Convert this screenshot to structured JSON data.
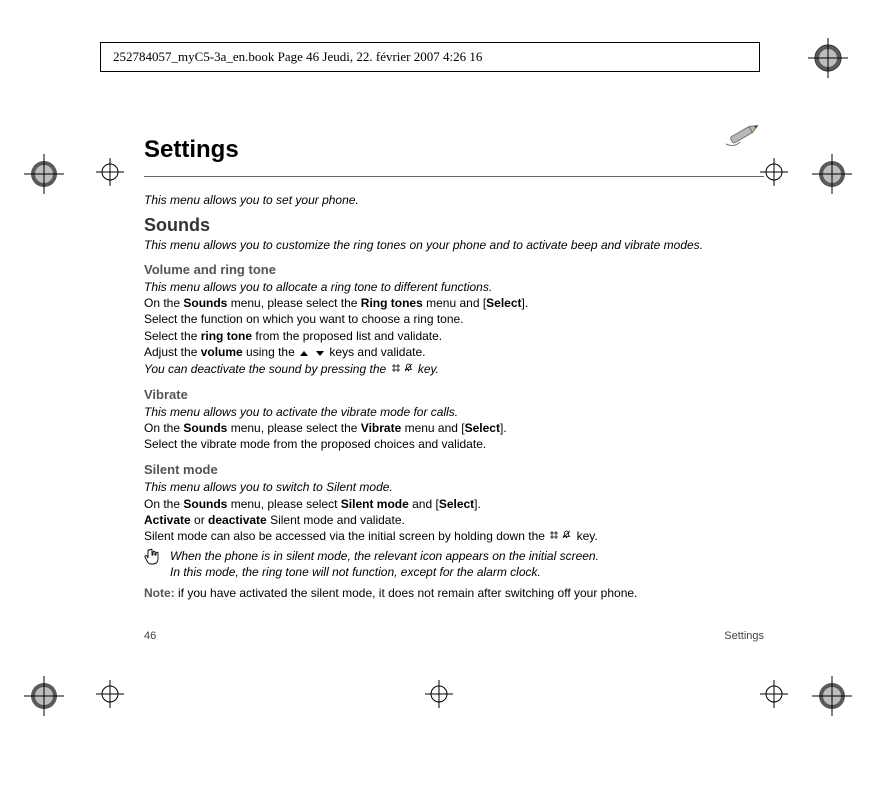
{
  "header": {
    "crop_text": "252784057_myC5-3a_en.book  Page 46  Jeudi, 22. février 2007  4:26 16"
  },
  "title": "Settings",
  "intro": "This menu allows you to set your phone.",
  "sounds": {
    "heading": "Sounds",
    "intro": "This menu allows you to customize the ring tones on your phone and to activate beep and vibrate modes.",
    "volume": {
      "heading": "Volume and ring tone",
      "l1": "This menu allows you to allocate a ring tone to different functions.",
      "l2a": "On the ",
      "l2b": "Sounds",
      "l2c": " menu, please select the ",
      "l2d": "Ring tones",
      "l2e": " menu and [",
      "l2f": "Select",
      "l2g": "].",
      "l3": "Select the function on which you want to choose a ring tone.",
      "l4a": "Select the ",
      "l4b": "ring tone",
      "l4c": " from the proposed list and validate.",
      "l5a": "Adjust the ",
      "l5b": "volume",
      "l5c": " using the ",
      "l5d": " keys and validate.",
      "l6a": "You can deactivate the sound by pressing the ",
      "l6b": " key."
    },
    "vibrate": {
      "heading": "Vibrate",
      "l1": "This menu allows you to activate the vibrate mode for calls.",
      "l2a": "On the ",
      "l2b": "Sounds",
      "l2c": " menu, please select the ",
      "l2d": "Vibrate",
      "l2e": " menu and [",
      "l2f": "Select",
      "l2g": "].",
      "l3": "Select the vibrate mode from the proposed choices and validate."
    },
    "silent": {
      "heading": "Silent mode",
      "l1": "This menu allows you to switch to Silent mode.",
      "l2a": "On the ",
      "l2b": "Sounds",
      "l2c": " menu, please select ",
      "l2d": "Silent mode",
      "l2e": " and [",
      "l2f": "Select",
      "l2g": "].",
      "l3a": "Activate",
      "l3b": " or ",
      "l3c": "deactivate",
      "l3d": " Silent mode and validate.",
      "l4a": "Silent mode can also be accessed via the initial screen by holding down the ",
      "l4b": " key.",
      "note1": "When the phone is in silent mode, the relevant icon appears on the initial screen.",
      "note2": "In this mode, the ring tone will not function, except for the alarm clock.",
      "l5a": "Note:",
      "l5b": " if you have activated the silent mode, it does not remain after switching off your phone."
    }
  },
  "footer": {
    "page": "46",
    "section": "Settings"
  }
}
